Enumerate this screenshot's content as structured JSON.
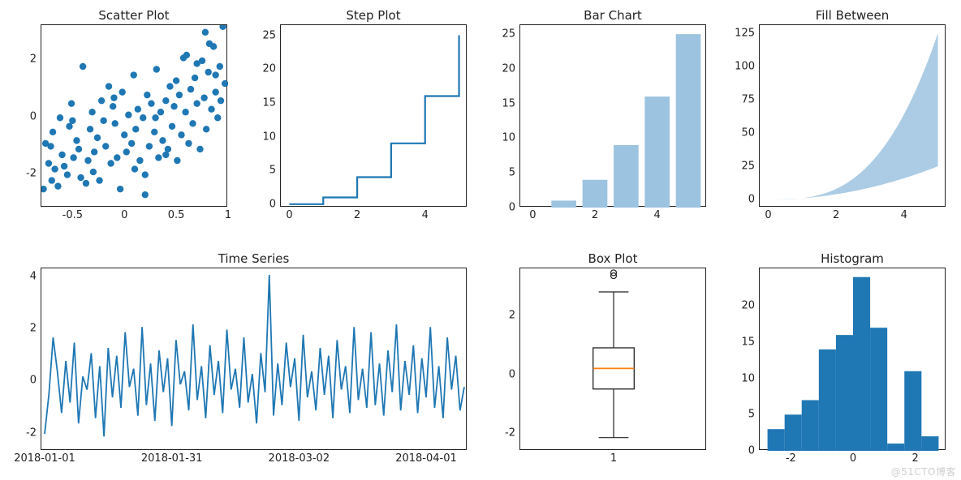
{
  "watermark": "@51CTO博客",
  "chart_data": [
    {
      "id": "scatter",
      "type": "scatter",
      "title": "Scatter Plot",
      "xlim": [
        -0.8,
        1.0
      ],
      "ylim": [
        -3.2,
        3.2
      ],
      "xticks": [
        -0.5,
        0.0,
        0.5,
        1.0
      ],
      "yticks": [
        -2,
        0,
        2
      ],
      "data": [
        [
          -0.78,
          -2.55
        ],
        [
          -0.76,
          -0.95
        ],
        [
          -0.73,
          -1.65
        ],
        [
          -0.71,
          -1.05
        ],
        [
          -0.69,
          -0.55
        ],
        [
          -0.67,
          -1.85
        ],
        [
          -0.64,
          -2.45
        ],
        [
          -0.62,
          -0.05
        ],
        [
          -0.6,
          -1.35
        ],
        [
          -0.58,
          -1.75
        ],
        [
          -0.55,
          -2.05
        ],
        [
          -0.53,
          -0.35
        ],
        [
          -0.51,
          0.45
        ],
        [
          -0.49,
          -1.45
        ],
        [
          -0.46,
          -0.85
        ],
        [
          -0.44,
          -1.15
        ],
        [
          -0.42,
          -2.15
        ],
        [
          -0.4,
          1.75
        ],
        [
          -0.37,
          -2.35
        ],
        [
          -0.35,
          -1.55
        ],
        [
          -0.33,
          -0.45
        ],
        [
          -0.31,
          0.15
        ],
        [
          -0.29,
          -1.25
        ],
        [
          -0.26,
          -0.75
        ],
        [
          -0.24,
          -2.25
        ],
        [
          -0.22,
          0.55
        ],
        [
          -0.2,
          -0.15
        ],
        [
          -0.18,
          -1.05
        ],
        [
          -0.15,
          1.05
        ],
        [
          -0.13,
          -1.65
        ],
        [
          -0.11,
          0.35
        ],
        [
          -0.09,
          -0.25
        ],
        [
          -0.07,
          -1.45
        ],
        [
          -0.04,
          -2.55
        ],
        [
          -0.02,
          0.85
        ],
        [
          0.0,
          -0.65
        ],
        [
          0.02,
          -1.25
        ],
        [
          0.04,
          0.05
        ],
        [
          0.07,
          -0.95
        ],
        [
          0.09,
          1.45
        ],
        [
          0.11,
          -0.45
        ],
        [
          0.13,
          0.25
        ],
        [
          0.15,
          -1.55
        ],
        [
          0.18,
          -0.05
        ],
        [
          0.2,
          -2.75
        ],
        [
          0.22,
          0.75
        ],
        [
          0.24,
          -1.05
        ],
        [
          0.26,
          0.45
        ],
        [
          0.29,
          -0.55
        ],
        [
          0.31,
          1.65
        ],
        [
          0.33,
          -1.45
        ],
        [
          0.35,
          0.15
        ],
        [
          0.37,
          -0.85
        ],
        [
          0.4,
          0.55
        ],
        [
          0.42,
          -1.15
        ],
        [
          0.44,
          1.05
        ],
        [
          0.46,
          -0.35
        ],
        [
          0.48,
          0.35
        ],
        [
          0.51,
          -1.55
        ],
        [
          0.53,
          0.75
        ],
        [
          0.55,
          -0.65
        ],
        [
          0.57,
          2.05
        ],
        [
          0.59,
          0.15
        ],
        [
          0.62,
          -0.95
        ],
        [
          0.64,
          0.95
        ],
        [
          0.66,
          -0.25
        ],
        [
          0.68,
          1.35
        ],
        [
          0.7,
          0.45
        ],
        [
          0.73,
          -1.15
        ],
        [
          0.75,
          1.95
        ],
        [
          0.77,
          0.65
        ],
        [
          0.79,
          -0.45
        ],
        [
          0.81,
          1.55
        ],
        [
          0.84,
          0.25
        ],
        [
          0.86,
          2.45
        ],
        [
          0.88,
          0.85
        ],
        [
          0.9,
          -0.05
        ],
        [
          0.92,
          1.75
        ],
        [
          0.95,
          3.15
        ],
        [
          0.97,
          1.15
        ],
        [
          0.78,
          2.95
        ],
        [
          0.6,
          2.15
        ],
        [
          0.82,
          2.55
        ],
        [
          0.7,
          1.85
        ],
        [
          0.88,
          1.45
        ],
        [
          0.93,
          0.55
        ],
        [
          0.5,
          1.25
        ],
        [
          0.3,
          -0.05
        ],
        [
          0.1,
          -1.85
        ],
        [
          -0.1,
          0.65
        ],
        [
          -0.3,
          -1.95
        ],
        [
          -0.5,
          -0.15
        ],
        [
          -0.7,
          -2.25
        ],
        [
          0.4,
          -1.35
        ],
        [
          0.2,
          -2.05
        ]
      ]
    },
    {
      "id": "step",
      "type": "step",
      "title": "Step Plot",
      "xlim": [
        -0.25,
        5.25
      ],
      "ylim": [
        -0.5,
        26.5
      ],
      "xticks": [
        0,
        2,
        4
      ],
      "yticks": [
        0,
        5,
        10,
        15,
        20,
        25
      ],
      "x": [
        0,
        1,
        2,
        3,
        4,
        5
      ],
      "y": [
        0,
        1,
        4,
        9,
        16,
        25
      ]
    },
    {
      "id": "bar",
      "type": "bar",
      "title": "Bar Chart",
      "xlim": [
        -0.4,
        5.6
      ],
      "ylim": [
        0,
        26.3
      ],
      "xticks": [
        0,
        2,
        4
      ],
      "yticks": [
        0,
        5,
        10,
        15,
        20,
        25
      ],
      "categories": [
        1,
        2,
        3,
        4,
        5
      ],
      "values": [
        1,
        4,
        9,
        16,
        25
      ]
    },
    {
      "id": "fill",
      "type": "area",
      "title": "Fill Between",
      "xlim": [
        -0.25,
        5.25
      ],
      "ylim": [
        -6,
        131
      ],
      "xticks": [
        0,
        2,
        4
      ],
      "yticks": [
        0,
        25,
        50,
        75,
        100,
        125
      ],
      "x": [
        0.0,
        0.5,
        1.0,
        1.5,
        2.0,
        2.5,
        3.0,
        3.5,
        4.0,
        4.5,
        5.0
      ],
      "y_lo": [
        0.0,
        0.125,
        1.0,
        3.375,
        8.0,
        15.625,
        27.0,
        42.875,
        64.0,
        91.125,
        25.0
      ],
      "y_hi": [
        0.0,
        0.25,
        1.0,
        2.25,
        4.0,
        6.25,
        9.0,
        12.25,
        16.0,
        20.25,
        125.0
      ],
      "note": "fill between x^2 and x^3 on [0,5]"
    },
    {
      "id": "ts",
      "type": "line",
      "title": "Time Series",
      "ylim": [
        -2.7,
        4.3
      ],
      "yticks": [
        -2,
        0,
        2,
        4
      ],
      "x_dates": [
        "2018-01-01",
        "2018-01-31",
        "2018-03-02",
        "2018-04-01"
      ],
      "x_date_positions": [
        0,
        30,
        60,
        90
      ],
      "n": 100,
      "start": "2018-01-01",
      "y": [
        -2.05,
        -0.55,
        1.65,
        0.35,
        -1.25,
        0.75,
        -0.85,
        1.45,
        -1.65,
        0.15,
        -0.35,
        1.05,
        -1.45,
        0.55,
        -2.15,
        1.25,
        -0.65,
        0.95,
        -1.05,
        1.85,
        -0.25,
        0.45,
        -1.35,
        2.05,
        -0.95,
        0.65,
        -1.55,
        1.15,
        -0.45,
        0.85,
        -1.75,
        1.55,
        -0.15,
        0.35,
        -1.15,
        2.15,
        -0.75,
        0.55,
        -1.45,
        1.35,
        -0.55,
        0.75,
        -1.25,
        1.95,
        -0.35,
        0.45,
        -1.05,
        1.65,
        -0.85,
        0.25,
        -1.65,
        1.05,
        -0.45,
        4.05,
        -1.35,
        0.65,
        -0.95,
        1.45,
        -0.25,
        0.85,
        -1.55,
        1.75,
        -0.65,
        0.35,
        -1.15,
        1.25,
        -0.55,
        0.95,
        -1.45,
        1.55,
        -0.35,
        0.55,
        -1.25,
        2.05,
        -0.75,
        0.45,
        -1.05,
        1.85,
        -0.95,
        0.65,
        -1.35,
        1.15,
        -0.45,
        2.15,
        -1.15,
        0.75,
        -0.55,
        1.35,
        -1.25,
        0.85,
        -0.65,
        2.05,
        -1.05,
        0.55,
        -1.45,
        1.65,
        -0.35,
        0.95,
        -1.15,
        -0.25
      ]
    },
    {
      "id": "box",
      "type": "boxplot",
      "title": "Box Plot",
      "xlim": [
        0.5,
        1.5
      ],
      "ylim": [
        -2.6,
        3.6
      ],
      "xticks": [
        1
      ],
      "yticks": [
        -2,
        0,
        2
      ],
      "stats": {
        "whisker_lo": -2.15,
        "q1": -0.5,
        "median": 0.2,
        "q3": 0.9,
        "whisker_hi": 2.8,
        "outliers": [
          3.35,
          3.45
        ]
      }
    },
    {
      "id": "hist",
      "type": "histogram",
      "title": "Histogram",
      "xlim": [
        -3.0,
        3.0
      ],
      "ylim": [
        0,
        25.2
      ],
      "xticks": [
        -2,
        0,
        2
      ],
      "yticks": [
        0,
        5,
        10,
        15,
        20
      ],
      "bin_edges": [
        -2.75,
        -2.2,
        -1.65,
        -1.1,
        -0.55,
        0.0,
        0.55,
        1.1,
        1.65,
        2.2,
        2.75
      ],
      "counts": [
        3,
        5,
        7,
        14,
        16,
        24,
        17,
        1,
        11,
        2
      ]
    }
  ]
}
